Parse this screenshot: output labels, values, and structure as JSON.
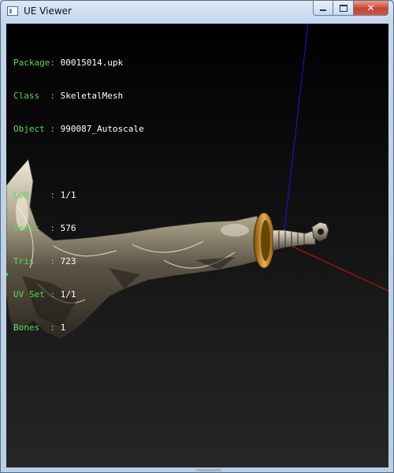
{
  "window": {
    "title": "UE Viewer"
  },
  "info": {
    "package": {
      "key": "Package:",
      "value": "00015014.upk"
    },
    "class": {
      "key": "Class  :",
      "value": "SkeletalMesh"
    },
    "object": {
      "key": "Object :",
      "value": "990087_Autoscale"
    },
    "lod": {
      "key": "LOD    :",
      "value": "1/1"
    },
    "verts": {
      "key": "Verts  :",
      "value": "576"
    },
    "tris": {
      "key": "Tris   :",
      "value": "723"
    },
    "uvset": {
      "key": "UV Set :",
      "value": "1/1"
    },
    "bones": {
      "key": "Bones  :",
      "value": "1"
    }
  },
  "colors": {
    "label": "#5bd85b",
    "value": "#ffffff",
    "axis_x": "#cc1111",
    "axis_z": "#1a1acc",
    "mesh_silver": "#c9bfa6",
    "mesh_gold": "#c8901e"
  },
  "icons": [
    "app-icon",
    "minimize-icon",
    "maximize-icon",
    "close-icon"
  ]
}
